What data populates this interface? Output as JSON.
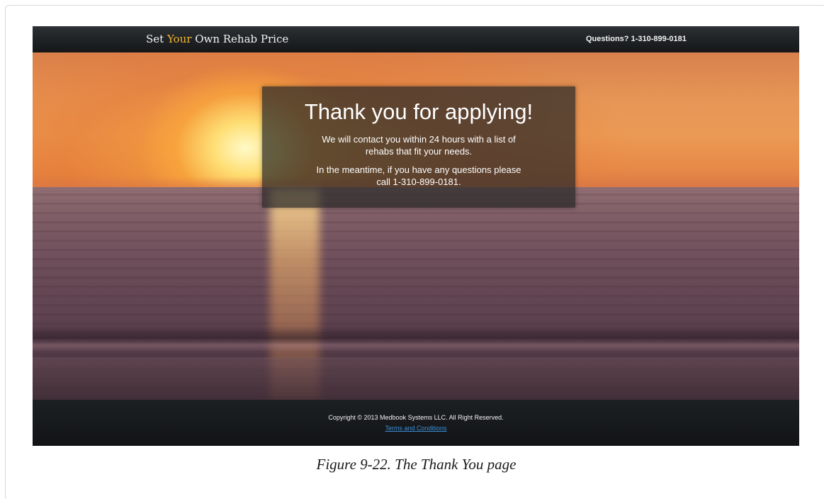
{
  "header": {
    "brand_prefix": "Set ",
    "brand_accent": "Your",
    "brand_suffix": " Own Rehab Price",
    "phone": "Questions? 1-310-899-0181"
  },
  "panel": {
    "title": "Thank you for applying!",
    "message_1": "We will contact you within 24 hours with a list of rehabs that fit your needs.",
    "message_2": "In the meantime, if you have any questions please call 1-310-899-0181."
  },
  "footer": {
    "copyright": "Copyright © 2013 Medbook Systems LLC.  All Right Reserved.",
    "terms_link": "Terms and Conditions"
  },
  "caption": "Figure 9-22. The Thank You page",
  "colors": {
    "accent": "#f2b630",
    "link": "#3b8fd8",
    "bar": "#1d2023"
  }
}
